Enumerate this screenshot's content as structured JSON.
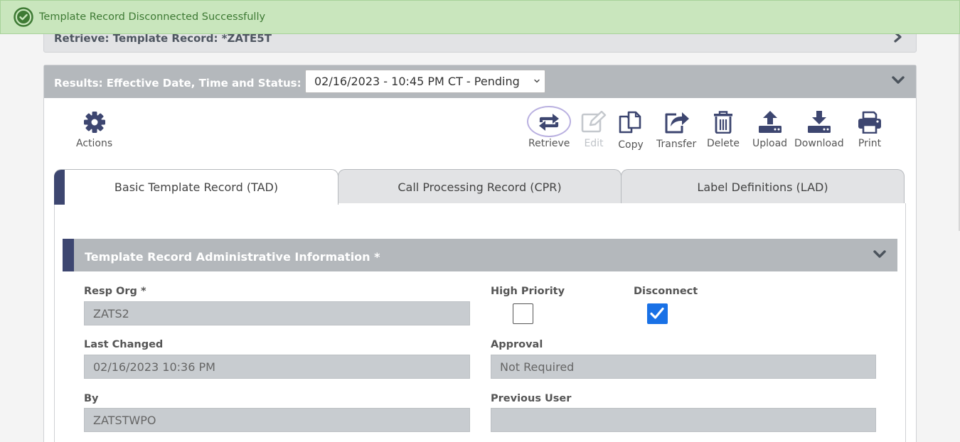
{
  "toast": {
    "message": "Template Record Disconnected Successfully",
    "color": "#3e7a34"
  },
  "retrieve": {
    "title": "Retrieve: Template Record: *ZATE5T"
  },
  "results": {
    "label": "Results: Effective Date, Time and Status:",
    "selected_date": "02/16/2023 - 10:45 PM CT - Pending"
  },
  "toolbar": {
    "actions": "Actions",
    "retrieve": "Retrieve",
    "edit": "Edit",
    "copy": "Copy",
    "transfer": "Transfer",
    "delete": "Delete",
    "upload": "Upload",
    "download": "Download",
    "print": "Print"
  },
  "tabs": [
    {
      "label": "Basic Template Record (TAD)",
      "active": true
    },
    {
      "label": "Call Processing Record (CPR)",
      "active": false
    },
    {
      "label": "Label Definitions (LAD)",
      "active": false
    }
  ],
  "section": {
    "title": "Template Record Administrative Information *"
  },
  "fields": {
    "resp_org": {
      "label": "Resp Org *",
      "value": "ZATS2"
    },
    "high_priority": {
      "label": "High Priority",
      "checked": false
    },
    "disconnect": {
      "label": "Disconnect",
      "checked": true
    },
    "last_changed": {
      "label": "Last Changed",
      "value": "02/16/2023 10:36 PM"
    },
    "approval": {
      "label": "Approval",
      "value": "Not Required"
    },
    "by": {
      "label": "By",
      "value": "ZATSTWPO"
    },
    "previous_user": {
      "label": "Previous User",
      "value": ""
    }
  },
  "colors": {
    "accent": "#3d4670",
    "header_gray": "#b4b8bc",
    "check_blue": "#1971e6",
    "icon": "#3d4670"
  }
}
